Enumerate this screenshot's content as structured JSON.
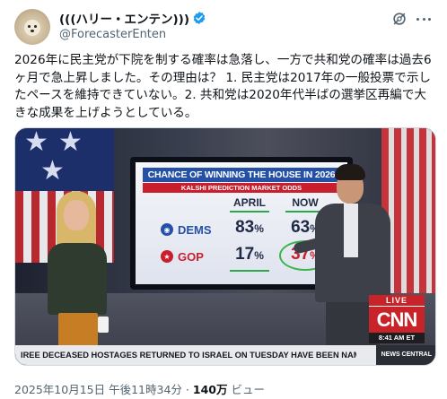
{
  "author": {
    "display_name": "(((ハリー・エンテン)))",
    "handle": "@ForecasterEnten",
    "verified": true,
    "verified_color": "#1d9bf0"
  },
  "actions": {
    "grok_icon": "grok-icon",
    "more_icon": "more-icon"
  },
  "tweet": {
    "text": "2026年に民主党が下院を制する確率は急落し、一方で共和党の確率は過去6ヶ月で急上昇しました。その理由は？ 1. 民主党は2017年の一般投票で示したペースを維持できていない。2. 共和党は2020年代半ばの選挙区再編で大きな成果を上げようとしている。"
  },
  "media": {
    "screen": {
      "title": "CHANCE OF WINNING THE HOUSE IN 2026",
      "subtitle": "KALSHI PREDICTION MARKET ODDS",
      "col_april": "APRIL",
      "col_now": "NOW",
      "dems_label": "DEMS",
      "gop_label": "GOP",
      "dems_april": "83",
      "dems_now": "63",
      "gop_april": "17",
      "gop_now": "37",
      "pct_sign": "%"
    },
    "broadcast": {
      "live": "LIVE",
      "logo": "CNN",
      "time": "8:41 AM ET",
      "ticker": "IREE DECEASED HOSTAGES RETURNED TO ISRAEL ON TUESDAY HAVE BEEN NAMED. T",
      "ticker_brand": "NEWS CENTRAL"
    },
    "colors": {
      "dem_blue": "#2450a8",
      "gop_red": "#c91f2c",
      "cnn_red": "#c9232a",
      "highlight_green": "#39b54a"
    }
  },
  "meta": {
    "timestamp": "2025年10月15日 午後11時34分",
    "separator": "·",
    "views_count": "140万",
    "views_label": "ビュー"
  }
}
